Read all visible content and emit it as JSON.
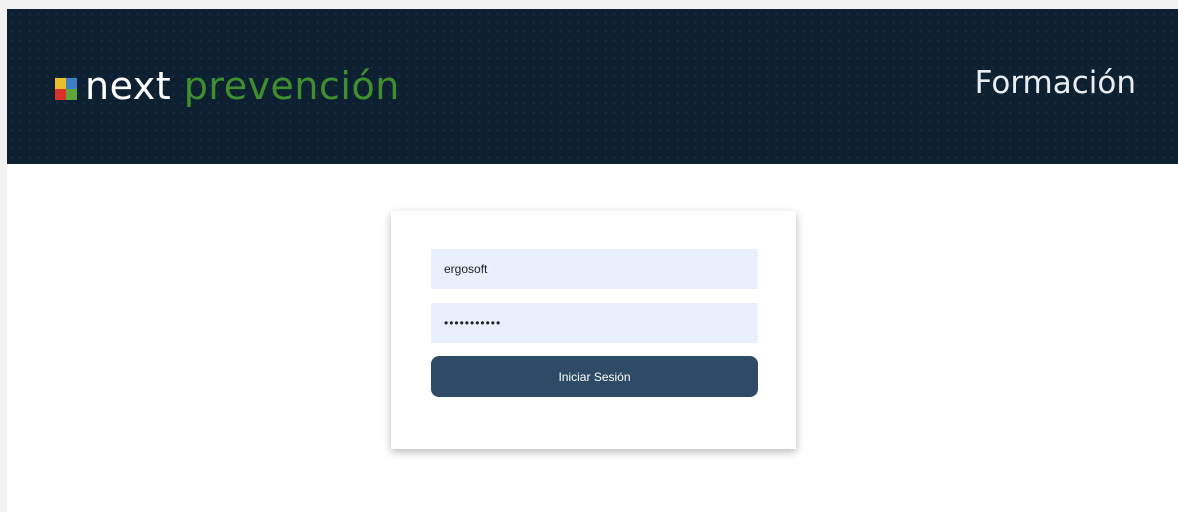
{
  "header": {
    "logo_word1": "next",
    "logo_word2": "prevención",
    "section_title": "Formación"
  },
  "login_form": {
    "username_value": "ergosoft",
    "password_value": "ergosoft123",
    "submit_label": "Iniciar Sesión"
  },
  "colors": {
    "header_bg": "#0c2031",
    "logo_accent": "#3f8f2f",
    "button_bg": "#2d4a66",
    "input_bg": "#e8f0fe"
  }
}
